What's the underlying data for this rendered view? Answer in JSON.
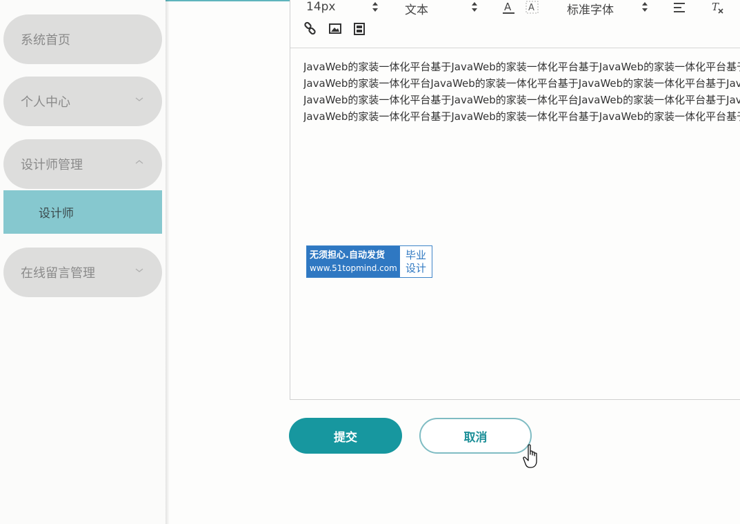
{
  "sidebar": {
    "items": [
      {
        "label": "系统首页"
      },
      {
        "label": "个人中心"
      },
      {
        "label": "设计师管理"
      },
      {
        "label": "在线留言管理"
      }
    ],
    "submenu": {
      "label": "设计师"
    }
  },
  "editor": {
    "toolbar": {
      "font_size": "14px",
      "paragraph": "文本",
      "font_family": "标准字体"
    },
    "lines": [
      "JavaWeb的家装一体化平台基于JavaWeb的家装一体化平台基于JavaWeb的家装一体化平台基于",
      "JavaWeb的家装一体化平台JavaWeb的家装一体化平台基于JavaWeb的家装一体化平台基于Java",
      "JavaWeb的家装一体化平台基于JavaWeb的家装一体化平台JavaWeb的家装一体化平台基于Java",
      "JavaWeb的家装一体化平台基于JavaWeb的家装一体化平台基于JavaWeb的家装一体化平台基于"
    ]
  },
  "watermark": {
    "line1": "无须担心.自动发货",
    "line2": "www.51topmind.com",
    "right1": "毕业",
    "right2": "设计"
  },
  "buttons": {
    "submit": "提交",
    "cancel": "取消"
  },
  "colors": {
    "accent": "#17979f",
    "submenu_bg": "#86c8cf",
    "menu_bg": "#dddddc"
  }
}
